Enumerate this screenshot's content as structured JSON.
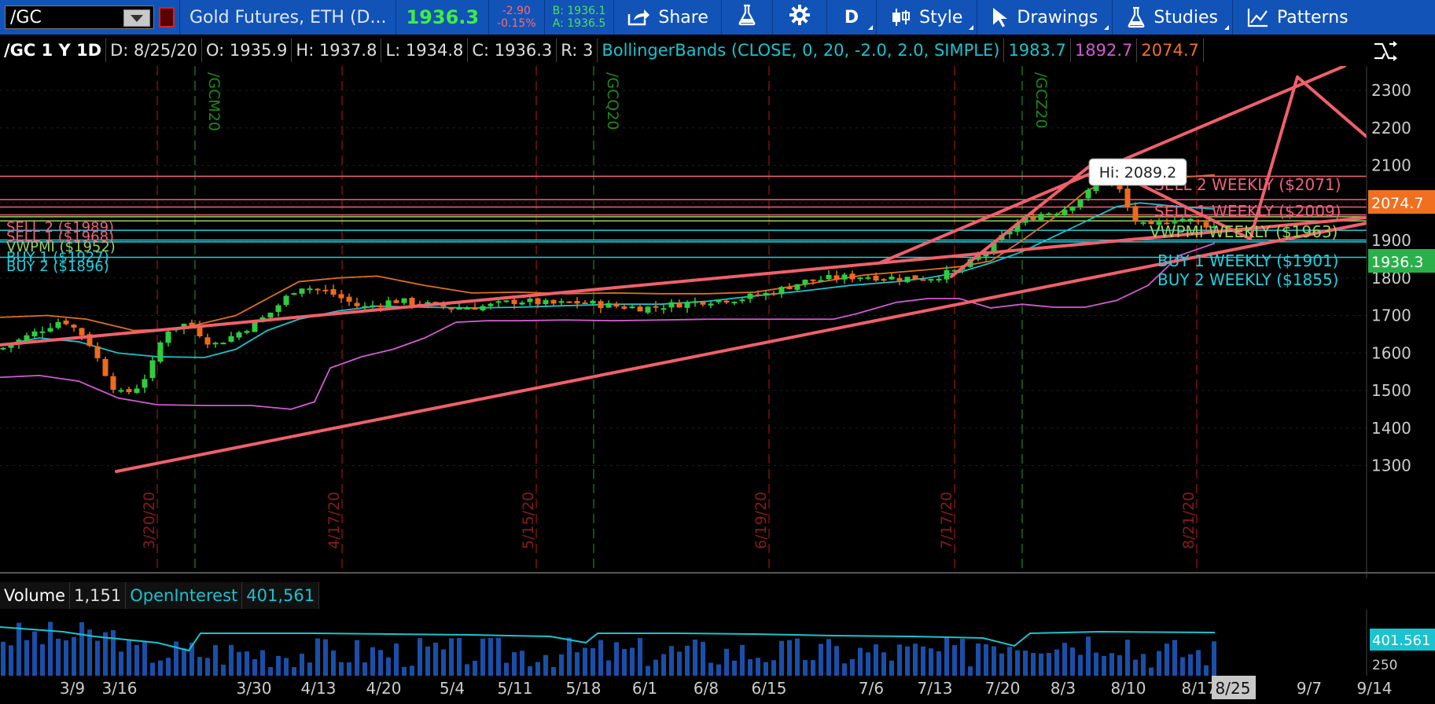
{
  "toolbar": {
    "symbol": "/GC",
    "instrument": "Gold Futures, ETH (D...",
    "last": "1936.3",
    "change": "-2.90",
    "change_pct": "-0.15%",
    "bid": "B: 1936.1",
    "ask": "A: 1936.5",
    "share": "Share",
    "aggregation": "D",
    "style": "Style",
    "drawings": "Drawings",
    "studies": "Studies",
    "patterns": "Patterns"
  },
  "statusbar": {
    "title": "/GC 1 Y 1D",
    "date": "D: 8/25/20",
    "open": "O: 1935.9",
    "high": "H: 1937.8",
    "low": "L: 1934.8",
    "close": "C: 1936.3",
    "range": "R: 3",
    "study": "BollingerBands (CLOSE, 0, 20, -2.0, 2.0, SIMPLE)",
    "bb_mid": "1983.7",
    "bb_lower": "1892.7",
    "bb_upper": "2074.7"
  },
  "chart": {
    "hi_label": "Hi: 2089.2",
    "price_ticks": [
      "2300",
      "2200",
      "2100",
      "2000",
      "1900",
      "1800",
      "1700",
      "1600",
      "1500",
      "1400",
      "1300"
    ],
    "price_tag_orange": "2074.7",
    "price_tag_green": "1936.3",
    "expiry_labels": [
      "/GCM20",
      "/GCQ20",
      "/GCZ20"
    ],
    "date_markers": [
      "3/20/20",
      "4/17/20",
      "5/15/20",
      "6/19/20",
      "7/17/20",
      "8/21/20"
    ],
    "levels_left": [
      "SELL 2 ($1989)",
      "SELL 1 ($1968)",
      "VWPMI ($1952)",
      "BUY 1 ($1927)",
      "BUY 2 ($1896)"
    ],
    "levels_weekly": [
      "SELL 2 WEEKLY ($2071)",
      "SELL 1 WEEKLY ($2009)",
      "VWPMI WEEKLY ($1963)",
      "BUY 1 WEEKLY ($1901)",
      "BUY 2 WEEKLY ($1855)"
    ]
  },
  "volume_panel": {
    "label": "Volume",
    "value": "1,151",
    "oi_label": "OpenInterest",
    "oi_value": "401,561",
    "tag": "401.561",
    "tick": "250"
  },
  "xaxis": {
    "labels": [
      "3/9",
      "3/16",
      "3/30",
      "4/13",
      "4/20",
      "5/4",
      "5/11",
      "5/18",
      "6/1",
      "6/8",
      "6/15",
      "7/6",
      "7/13",
      "7/20",
      "8/3",
      "8/10",
      "8/17",
      "8/25",
      "9/7",
      "9/14"
    ]
  },
  "colors": {
    "toolbar_bg": "#1253b8",
    "up": "#2ecc40",
    "down": "#f06a1c",
    "bb_mid": "#19c3cf",
    "bb_upper": "#e0701c",
    "bb_lower": "#d25ad2",
    "trendline": "#f0606a",
    "sell_level": "#f0607a",
    "buy_level": "#1fd0e0",
    "vwpmi_level": "#9bd060"
  },
  "chart_data": {
    "type": "candlestick",
    "title": "/GC 1 Y 1D",
    "xlabel": "",
    "ylabel": "",
    "ylim": [
      1200,
      2400
    ],
    "x": [
      "3/9",
      "3/16",
      "3/30",
      "4/13",
      "4/20",
      "5/4",
      "5/11",
      "5/18",
      "6/1",
      "6/8",
      "6/15",
      "7/6",
      "7/13",
      "7/20",
      "8/3",
      "8/10",
      "8/17",
      "8/25"
    ],
    "close": [
      1675,
      1480,
      1620,
      1745,
      1715,
      1710,
      1705,
      1740,
      1740,
      1720,
      1735,
      1790,
      1800,
      1890,
      2010,
      1940,
      1960,
      1936.3
    ],
    "series": [
      {
        "name": "BollingerBands upper",
        "values": [
          1700,
          1690,
          1740,
          1790,
          1800,
          1760,
          1750,
          1760,
          1760,
          1760,
          1760,
          1790,
          1820,
          1880,
          2030,
          2070,
          2060,
          2074.7
        ]
      },
      {
        "name": "BollingerBands middle",
        "values": [
          1640,
          1600,
          1600,
          1690,
          1720,
          1725,
          1720,
          1725,
          1725,
          1730,
          1730,
          1760,
          1790,
          1840,
          1940,
          1990,
          1985,
          1983.7
        ]
      },
      {
        "name": "BollingerBands lower",
        "values": [
          1580,
          1490,
          1460,
          1520,
          1660,
          1690,
          1690,
          1690,
          1690,
          1700,
          1700,
          1740,
          1760,
          1730,
          1730,
          1840,
          1880,
          1892.7
        ]
      }
    ],
    "annotations": [
      "Hi: 2089.2"
    ]
  }
}
